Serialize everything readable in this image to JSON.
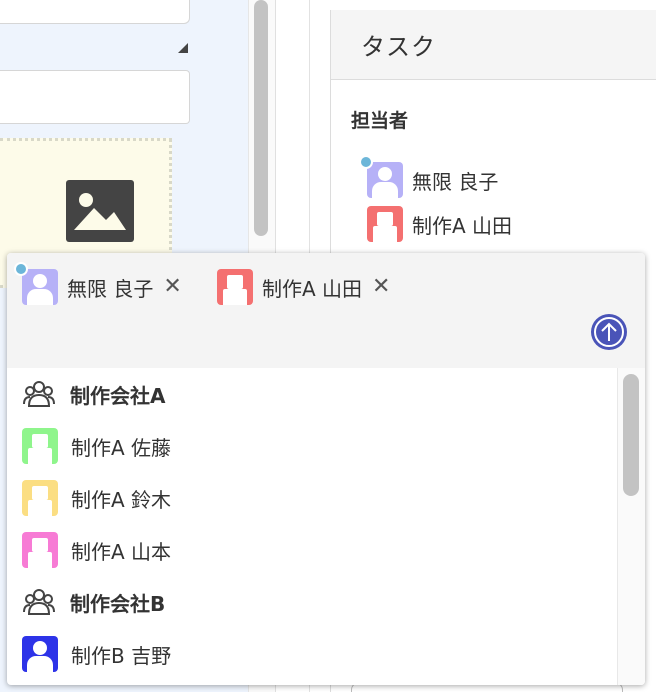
{
  "task_panel": {
    "header": "タスク",
    "assignee_label": "担当者",
    "assignees": [
      {
        "name": "無限 良子",
        "color": "#b6b1f7",
        "online": true,
        "avatar_style": "round"
      },
      {
        "name": "制作A 山田",
        "color": "#f47070",
        "online": false,
        "avatar_style": "square"
      }
    ]
  },
  "picker": {
    "selected": [
      {
        "name": "無限 良子",
        "color": "#b6b1f7",
        "online": true,
        "avatar_style": "round",
        "remove_label": "✕"
      },
      {
        "name": "制作A 山田",
        "color": "#f47070",
        "online": false,
        "avatar_style": "square",
        "remove_label": "✕"
      }
    ],
    "submit_icon": "arrow-up-circle-icon",
    "items": [
      {
        "type": "group",
        "name": "制作会社A",
        "icon": "group-icon"
      },
      {
        "type": "user",
        "name": "制作A 佐藤",
        "color": "#8ff58c",
        "avatar_style": "square"
      },
      {
        "type": "user",
        "name": "制作A 鈴木",
        "color": "#fbde83",
        "avatar_style": "square"
      },
      {
        "type": "user",
        "name": "制作A 山本",
        "color": "#f77bd5",
        "avatar_style": "square"
      },
      {
        "type": "group",
        "name": "制作会社B",
        "icon": "group-icon"
      },
      {
        "type": "user",
        "name": "制作B 吉野",
        "color": "#2d33e8",
        "avatar_style": "round"
      }
    ]
  },
  "colors": {
    "accent": "#4a54b8",
    "online_dot": "#6cb6d9",
    "header_bg": "#f5f5f5"
  }
}
